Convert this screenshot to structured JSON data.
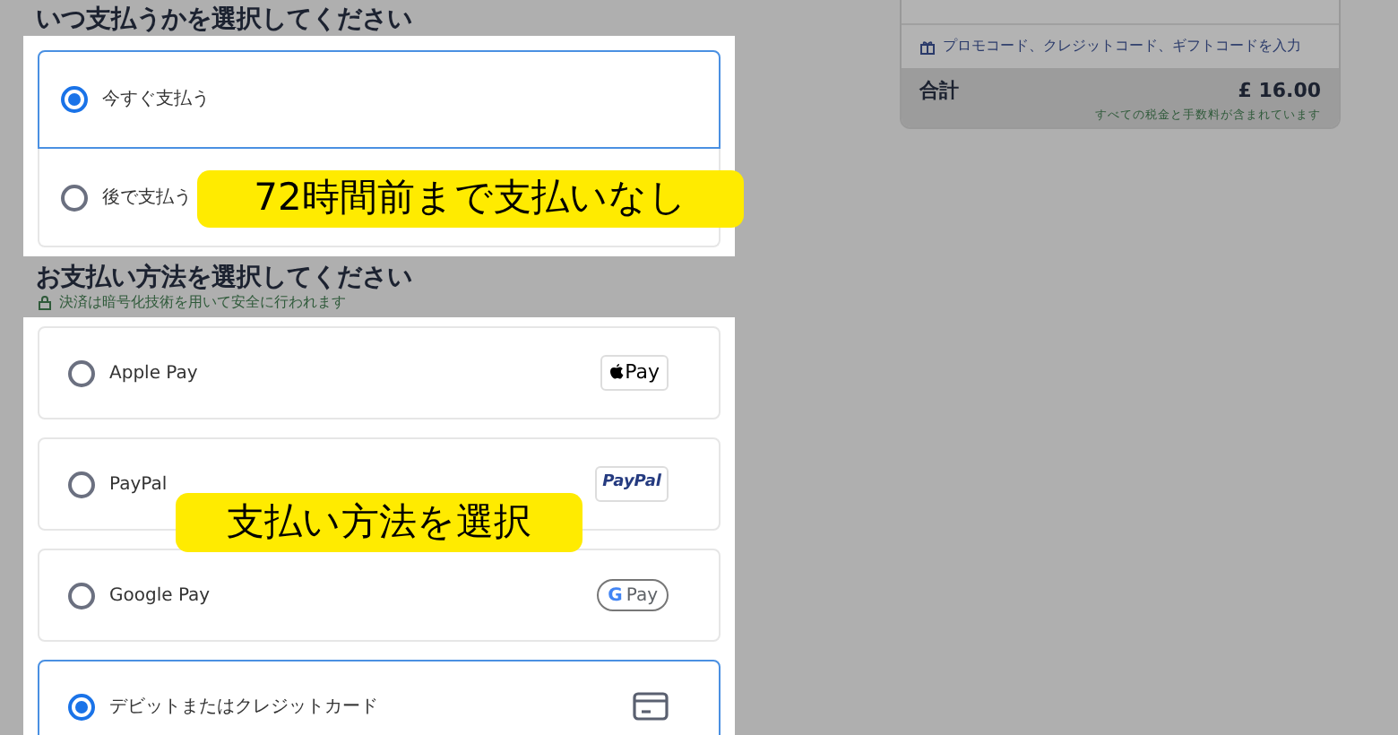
{
  "timing": {
    "title": "いつ支払うかを選択してください",
    "options": [
      {
        "label": "今すぐ支払う",
        "selected": true
      },
      {
        "label": "後で支払う",
        "selected": false
      }
    ]
  },
  "method": {
    "title": "お支払い方法を選択してください",
    "secure_note": "決済は暗号化技術を用いて安全に行われます",
    "options": [
      {
        "label": "Apple Pay",
        "selected": false,
        "kind": "apple",
        "badge": "Pay"
      },
      {
        "label": "PayPal",
        "selected": false,
        "kind": "paypal",
        "badge": "PayPal"
      },
      {
        "label": "Google Pay",
        "selected": false,
        "kind": "google",
        "badge_mark": "G",
        "badge": "Pay"
      },
      {
        "label": "デビットまたはクレジットカード",
        "selected": true,
        "kind": "card"
      }
    ]
  },
  "summary": {
    "promo_link": "プロモコード、クレジットコード、ギフトコードを入力",
    "total_label": "合計",
    "total_value": "£ 16.00",
    "tax_note": "すべての税金と手数料が含まれています"
  },
  "callouts": [
    "72時間前まで支払いなし",
    "支払い方法を選択"
  ]
}
